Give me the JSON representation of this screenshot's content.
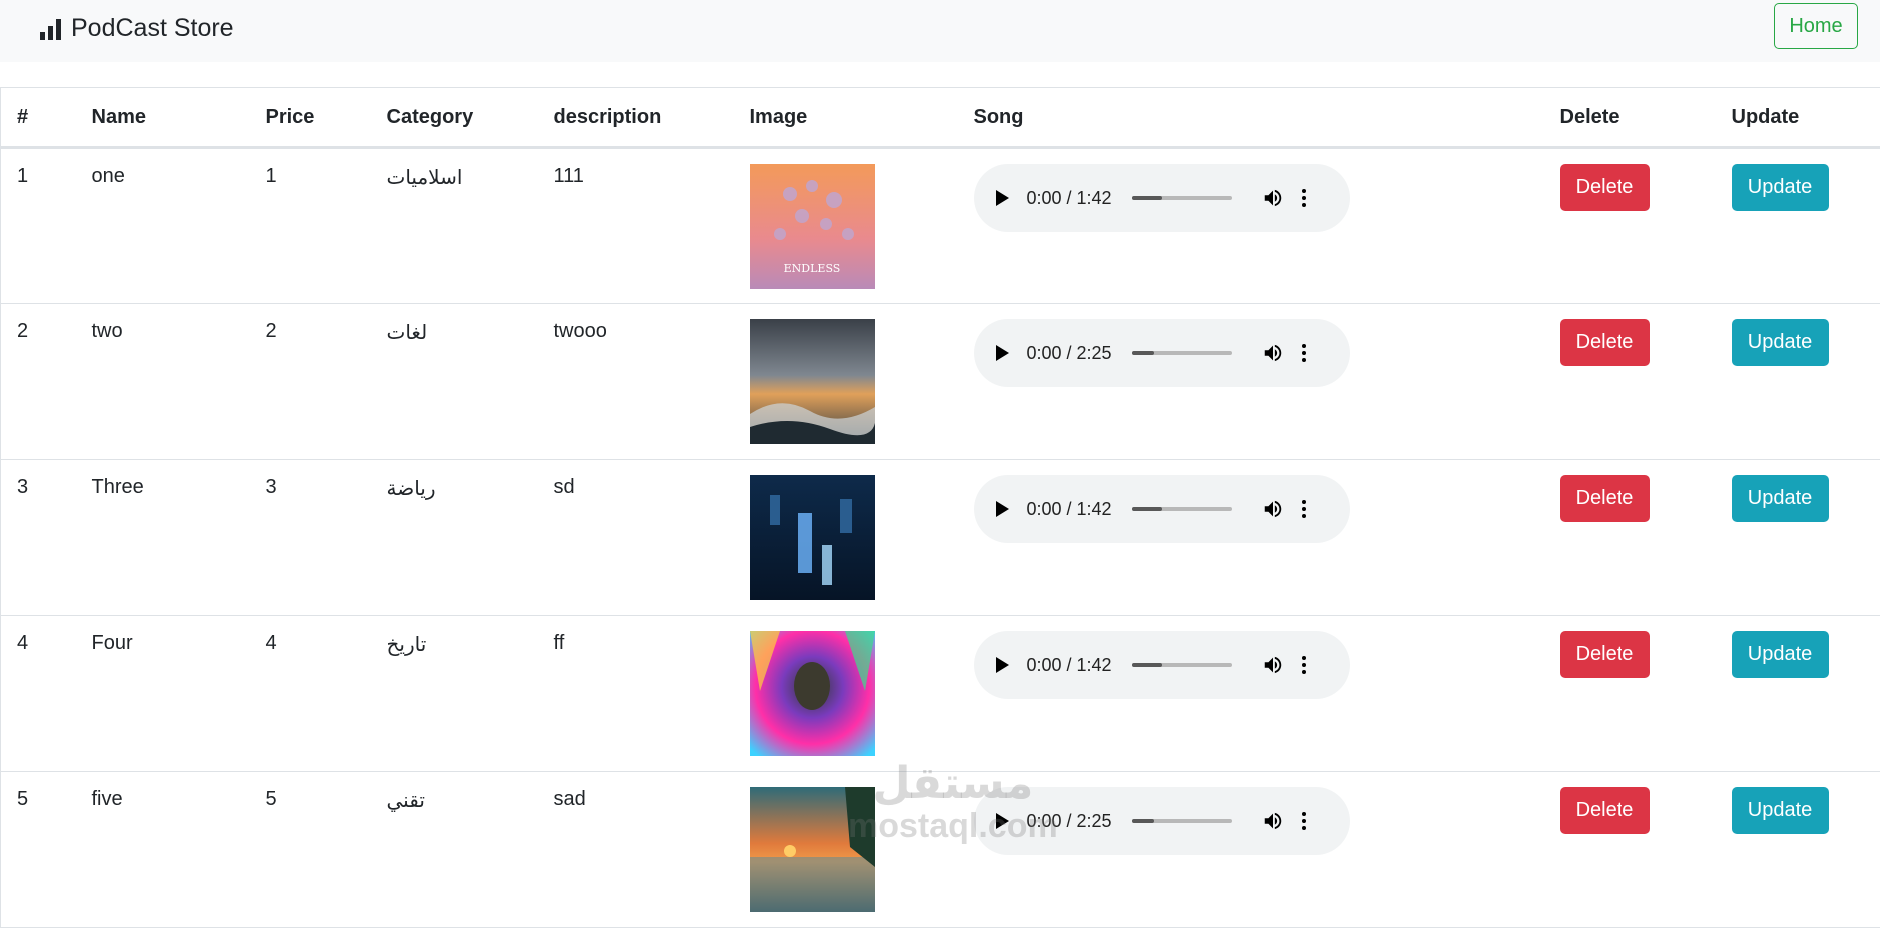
{
  "navbar": {
    "brand": "PodCast Store",
    "home_button": "Home"
  },
  "table": {
    "headers": [
      "#",
      "Name",
      "Price",
      "Category",
      "description",
      "Image",
      "Song",
      "Delete",
      "Update"
    ],
    "rows": [
      {
        "id": "1",
        "name": "one",
        "price": "1",
        "category": "اسلاميات",
        "description": "111",
        "time": "0:00 / 1:42",
        "progress": 0.3,
        "delete": "Delete",
        "update": "Update"
      },
      {
        "id": "2",
        "name": "two",
        "price": "2",
        "category": "لغات",
        "description": "twooo",
        "time": "0:00 / 2:25",
        "progress": 0.22,
        "delete": "Delete",
        "update": "Update"
      },
      {
        "id": "3",
        "name": "Three",
        "price": "3",
        "category": "رياضة",
        "description": "sd",
        "time": "0:00 / 1:42",
        "progress": 0.3,
        "delete": "Delete",
        "update": "Update"
      },
      {
        "id": "4",
        "name": "Four",
        "price": "4",
        "category": "تاريخ",
        "description": "ff",
        "time": "0:00 / 1:42",
        "progress": 0.3,
        "delete": "Delete",
        "update": "Update"
      },
      {
        "id": "5",
        "name": "five",
        "price": "5",
        "category": "تقني",
        "description": "sad",
        "time": "0:00 / 2:25",
        "progress": 0.22,
        "delete": "Delete",
        "update": "Update"
      }
    ]
  },
  "watermark": {
    "arabic": "مستقل",
    "latin": "mostaql.com"
  },
  "colors": {
    "delete": "#dc3545",
    "update": "#17a2b8",
    "home": "#28a745",
    "navbar_bg": "#f8f9fa"
  }
}
